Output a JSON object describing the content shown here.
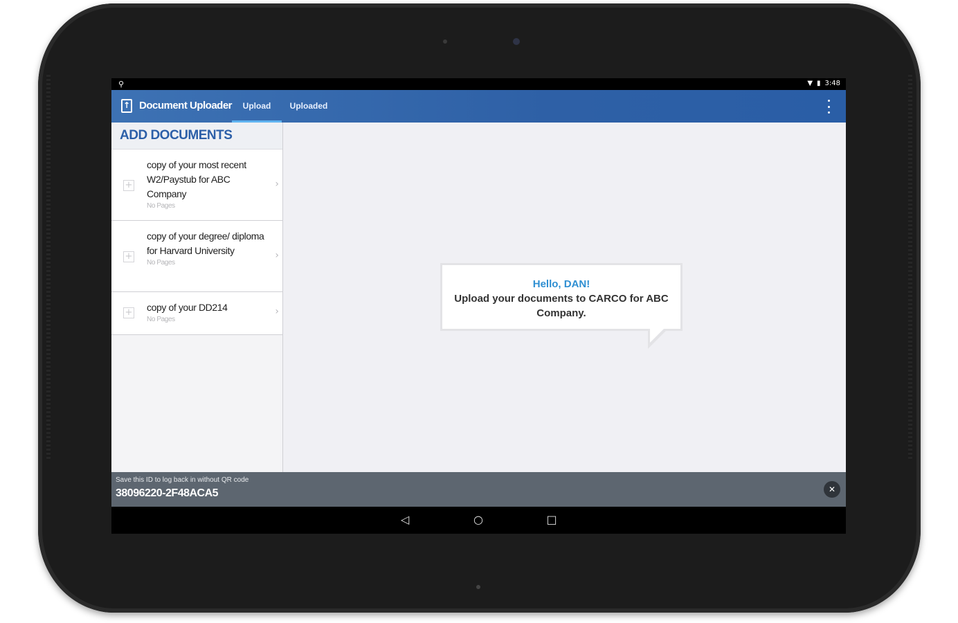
{
  "status_bar": {
    "time": "3:48"
  },
  "app_bar": {
    "title": "Document Uploader",
    "tabs": [
      {
        "label": "Upload",
        "active": true
      },
      {
        "label": "Uploaded",
        "active": false
      }
    ]
  },
  "sidebar": {
    "header": "ADD DOCUMENTS",
    "items": [
      {
        "label": "copy of your most recent W2/Paystub for ABC Company",
        "sub": "No Pages"
      },
      {
        "label": "copy of your degree/ diploma for Harvard University",
        "sub": "No Pages"
      },
      {
        "label": "copy of your DD214",
        "sub": "No Pages"
      }
    ]
  },
  "bubble": {
    "greeting": "Hello, DAN!",
    "message": "Upload your documents to CARCO for ABC Company."
  },
  "id_bar": {
    "label": "Save this ID to log back in without QR code",
    "id": "38096220-2F48ACA5"
  },
  "icons": {
    "app": "upload-document-icon",
    "overflow": "overflow-menu-icon",
    "close": "close-icon",
    "back": "nav-back-icon",
    "home": "nav-home-icon",
    "recents": "nav-recents-icon"
  },
  "colors": {
    "app_bar": "#2e60a6",
    "accent": "#2f8fd2",
    "tab_indicator": "#5fb3f0",
    "id_bar": "#5d6670"
  }
}
